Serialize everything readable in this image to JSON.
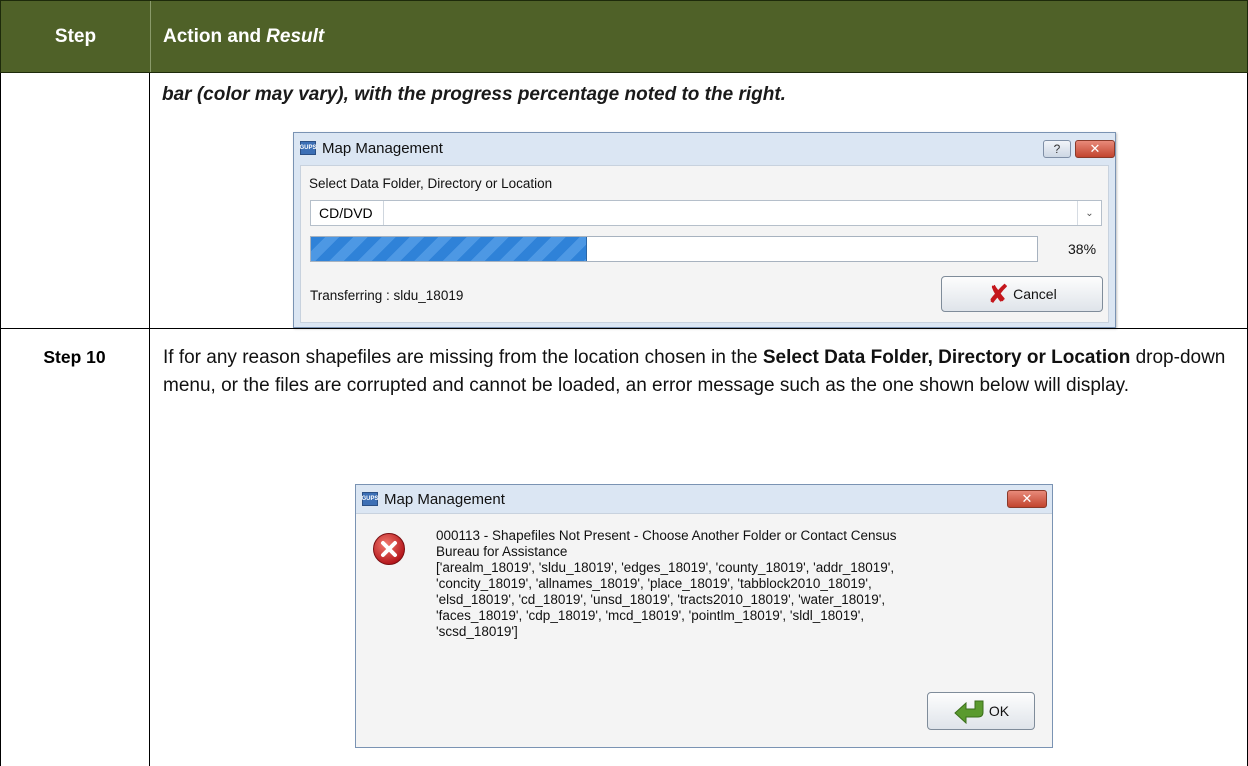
{
  "table": {
    "header_step": "Step",
    "header_action": "Action and",
    "header_result": "Result",
    "continued_text": "bar (color may vary), with the progress percentage noted to the right."
  },
  "dialog1": {
    "logo_text": "GUPS",
    "title": "Map Management",
    "help_icon": "?",
    "close_icon": "✕",
    "label": "Select Data Folder, Directory or Location",
    "combo_value": "CD/DVD",
    "progress_fraction": 0.38,
    "progress_label": "38%",
    "status_text": "Transferring : sldu_18019",
    "cancel_label": "Cancel"
  },
  "step10": {
    "label": "Step 10",
    "text_part1": "If for any reason shapefiles are missing from the location chosen in the ",
    "text_bold1": "Select Data Folder, Directory or Location",
    "text_part2": " drop-down menu, or the files are corrupted and cannot be loaded, an error message such as the one shown below will display."
  },
  "dialog2": {
    "logo_text": "GUPS",
    "title": "Map Management",
    "close_icon": "✕",
    "message_lines": [
      "000113 - Shapefiles Not Present - Choose Another Folder or Contact Census",
      "Bureau for Assistance",
      "['arealm_18019', 'sldu_18019', 'edges_18019', 'county_18019', 'addr_18019',",
      "'concity_18019', 'allnames_18019', 'place_18019', 'tabblock2010_18019',",
      "'elsd_18019', 'cd_18019', 'unsd_18019', 'tracts2010_18019', 'water_18019',",
      "'faces_18019', 'cdp_18019', 'mcd_18019', 'pointlm_18019', 'sldl_18019',",
      "'scsd_18019']"
    ],
    "ok_label": "OK"
  },
  "colors": {
    "header_bg": "#4f6128",
    "progress_fill": "#2f82d8",
    "error_red": "#c4161c"
  }
}
